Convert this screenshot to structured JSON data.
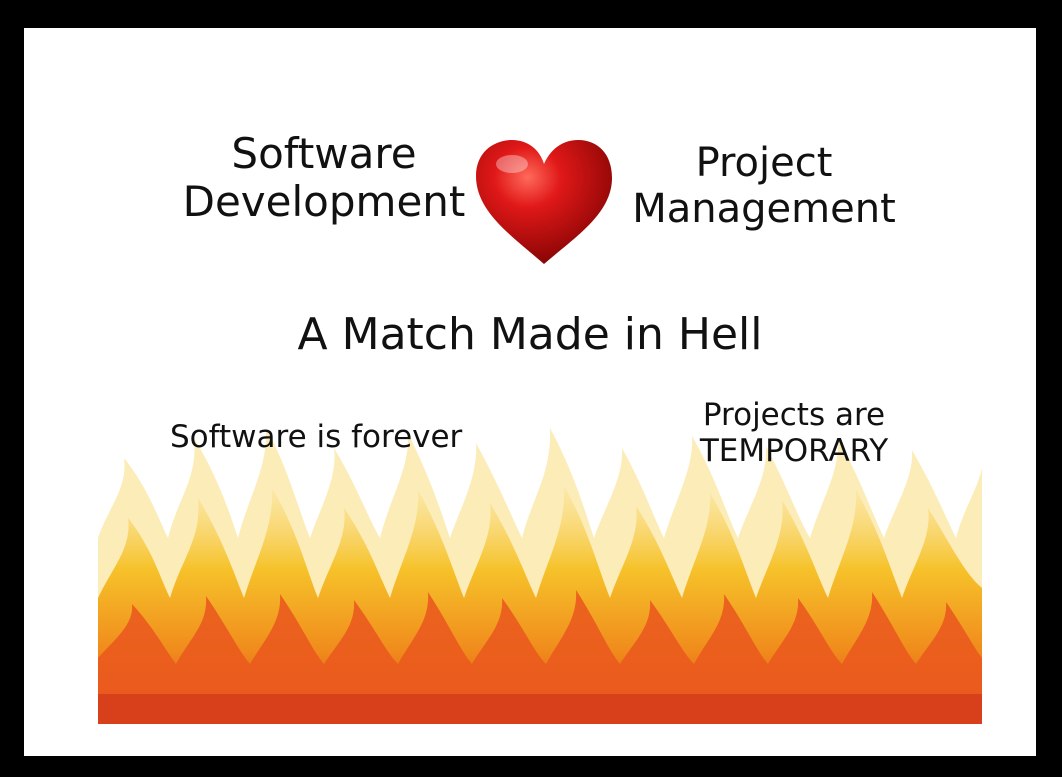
{
  "slide": {
    "left_title": [
      "Software",
      "Development"
    ],
    "right_title": [
      "Project",
      "Management"
    ],
    "tagline": "A Match Made in Hell",
    "left_note": "Software is forever",
    "right_note": [
      "Projects are",
      "TEMPORARY"
    ]
  },
  "icons": {
    "heart": "heart-icon",
    "fire": "flames-illustration"
  },
  "colors": {
    "frame": "#000000",
    "slide": "#ffffff",
    "text": "#111111",
    "heart": "#d41414",
    "fire_dark": "#d8401c",
    "fire_mid": "#f08a1c",
    "fire_light": "#f6c22a",
    "fire_pale": "#fbe6a0"
  }
}
